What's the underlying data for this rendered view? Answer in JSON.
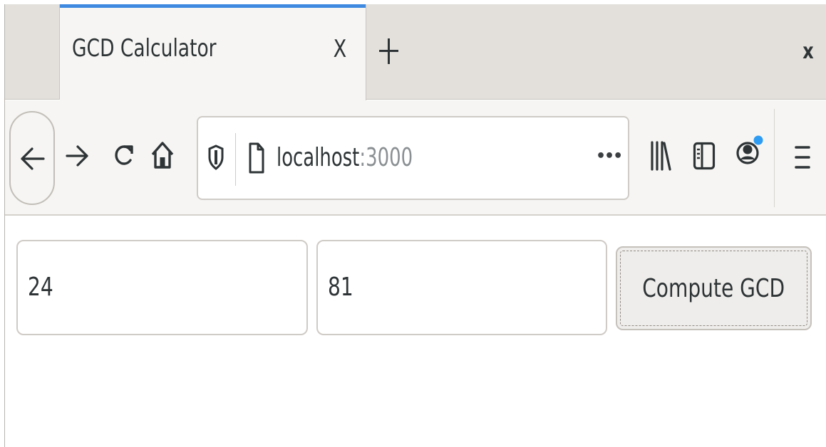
{
  "tab": {
    "title": "GCD Calculator",
    "close_label": "X",
    "accent_color": "#3f8ae0"
  },
  "window": {
    "close_label": "x"
  },
  "toolbar": {
    "icons": [
      "back-arrow-icon",
      "forward-arrow-icon",
      "reload-icon",
      "home-icon",
      "tracking-shield-icon",
      "page-icon",
      "page-actions-icon",
      "library-icon",
      "sidebar-icon",
      "account-icon",
      "menu-icon"
    ],
    "account_badge_color": "#2e9cf2"
  },
  "urlbar": {
    "host": "localhost",
    "port": ":3000",
    "more_label": "•••"
  },
  "form": {
    "input_a": "24",
    "input_b": "81",
    "compute_label": "Compute GCD"
  }
}
